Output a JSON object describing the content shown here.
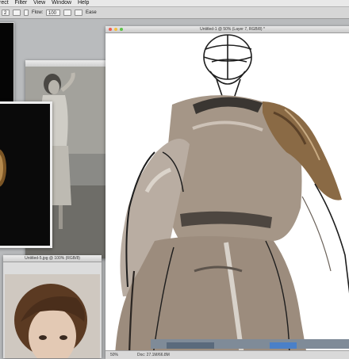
{
  "menubar": {
    "items": [
      "rect",
      "Filter",
      "View",
      "Window",
      "Help"
    ]
  },
  "optbar": {
    "mode_value": "2",
    "label_a": "Flow:",
    "value_a": "100",
    "label_b": "Ease"
  },
  "main_window": {
    "title": "Untitled-1 @ 50% (Layer 7, RGB/8) *",
    "zoom": "50%",
    "doc_info": "Doc: 27.1M/66.8M"
  },
  "photo_window": {
    "title": "Untitled-5.jpg @ 100% (RGB/8)"
  },
  "colors": {
    "workspace": "#b9bbbd",
    "canvas_bg": "#ffffff",
    "paint_taupe": "#a59687",
    "paint_ochre": "#8a6a45",
    "ink": "#1d1d1d",
    "close": "#ee5b50",
    "minimize": "#f4bd3f",
    "zoom_dot": "#5dc449"
  }
}
